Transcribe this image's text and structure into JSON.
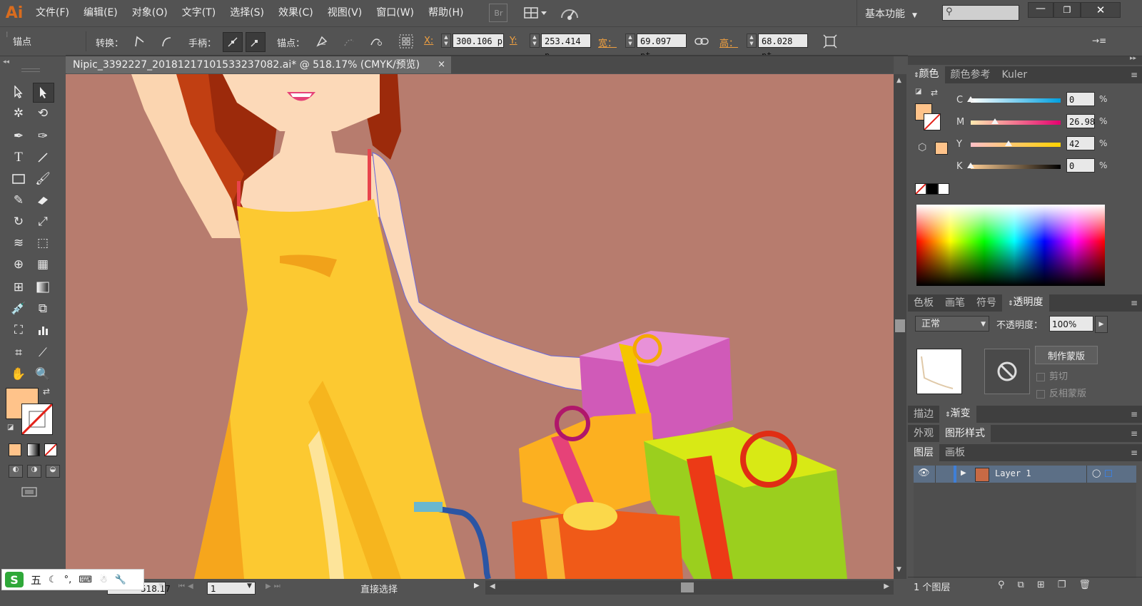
{
  "app": {
    "logo": "Ai",
    "menu": [
      "文件(F)",
      "编辑(E)",
      "对象(O)",
      "文字(T)",
      "选择(S)",
      "效果(C)",
      "视图(V)",
      "窗口(W)",
      "帮助(H)"
    ],
    "bridge_label": "Br",
    "workspace": "基本功能",
    "search_placeholder": ""
  },
  "control_bar": {
    "anchor_label": "锚点",
    "convert_label": "转换：",
    "handles_label": "手柄：",
    "anchors_label": "锚点：",
    "x_label": "X:",
    "x_value": "300.106 p",
    "y_label": "Y:",
    "y_value": "253.414 p",
    "width_label": "宽：",
    "width_value": "69.097 pt",
    "height_label": "高：",
    "height_value": "68.028 pt"
  },
  "document": {
    "tab_title": "Nipic_3392227_20181217101533237082.ai* @ 518.17% (CMYK/预览)",
    "close": "×"
  },
  "status_bar": {
    "zoom_value": "518.17",
    "artboard_value": "1",
    "tool_status": "直接选择",
    "ime_label": "五"
  },
  "color_panel": {
    "tabs": [
      "颜色",
      "颜色参考",
      "Kuler"
    ],
    "active_tab": "颜色",
    "channels": [
      {
        "label": "C",
        "value": "0",
        "percent": 0,
        "gradient": "linear-gradient(to right,#fff,#00a0e0)"
      },
      {
        "label": "M",
        "value": "26.98",
        "percent": 26.98,
        "gradient": "linear-gradient(to right,#ffe9b0,#e4006f)"
      },
      {
        "label": "Y",
        "value": "42",
        "percent": 42,
        "gradient": "linear-gradient(to right,#ffc0c8,#ffd200)"
      },
      {
        "label": "K",
        "value": "0",
        "percent": 0,
        "gradient": "linear-gradient(to right,#ffcf96,#000)"
      }
    ],
    "percent_sign": "%",
    "fill_color": "#ffc38a"
  },
  "transparency_panel": {
    "tabs": [
      "色板",
      "画笔",
      "符号",
      "透明度"
    ],
    "active_tab": "透明度",
    "blend_mode": "正常",
    "opacity_label": "不透明度：",
    "opacity_value": "100%",
    "make_mask_button": "制作蒙版",
    "clip_label": "剪切",
    "invert_label": "反相蒙版"
  },
  "stroke_tabs": [
    "描边",
    "渐变"
  ],
  "appearance_tabs": [
    "外观",
    "图形样式"
  ],
  "layers_panel": {
    "tabs": [
      "图层",
      "画板"
    ],
    "layer_name": "Layer 1",
    "count_label": "1 个图层"
  },
  "colors": {
    "canvas_bg": "#b77c6e",
    "ui_bg": "#535353",
    "accent": "#f0a040",
    "fill": "#ffc38a"
  }
}
